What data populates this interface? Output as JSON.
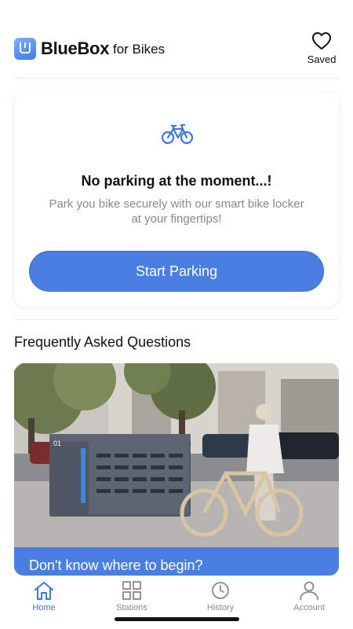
{
  "header": {
    "brand_name": "BlueBox",
    "brand_suffix": "for Bikes",
    "saved_label": "Saved"
  },
  "parking_card": {
    "icon": "bicycle-icon",
    "title": "No parking at the moment...!",
    "description": "Park you bike securely with our smart bike locker at your fingertips!",
    "button_label": "Start Parking"
  },
  "faq": {
    "section_title": "Frequently Asked Questions",
    "banner_text": "Don't know where to begin?",
    "image_locker_label": "01"
  },
  "tabbar": {
    "items": [
      {
        "label": "Home",
        "icon": "home-icon",
        "active": true
      },
      {
        "label": "Stations",
        "icon": "grid-icon",
        "active": false
      },
      {
        "label": "History",
        "icon": "clock-icon",
        "active": false
      },
      {
        "label": "Account",
        "icon": "person-icon",
        "active": false
      }
    ]
  },
  "colors": {
    "accent": "#4a7fe2",
    "active_tab": "#3b78e7",
    "muted_text": "#8a8a8e"
  }
}
